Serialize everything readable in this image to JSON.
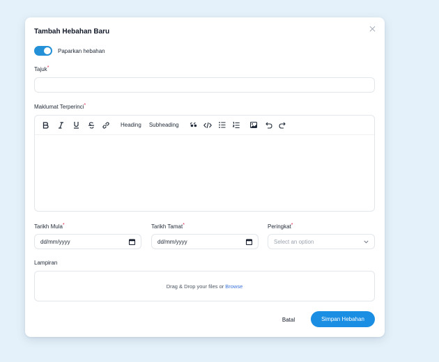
{
  "modal": {
    "title": "Tambah Hebahan Baru",
    "close_icon": "close-icon"
  },
  "toggle": {
    "label": "Paparkan hebahan",
    "on": true,
    "color": "#2490d8"
  },
  "fields": {
    "tajuk": {
      "label": "Tajuk",
      "required_mark": "*",
      "value": ""
    },
    "maklumat": {
      "label": "Maklumat Terperinci",
      "required_mark": "*",
      "value": ""
    },
    "tarikh_mula": {
      "label": "Tarikh Mula",
      "required_mark": "*",
      "value": "dd/mm/yyyy"
    },
    "tarikh_tamat": {
      "label": "Tarikh Tamat",
      "required_mark": "*",
      "value": "dd/mm/yyyy"
    },
    "peringkat": {
      "label": "Peringkat",
      "required_mark": "*",
      "placeholder": "Select an option"
    },
    "lampiran": {
      "label": "Lampiran"
    }
  },
  "toolbar": {
    "items": [
      "bold-icon",
      "italic-icon",
      "underline-icon",
      "strikethrough-icon",
      "link-icon",
      "quote-icon",
      "code-icon",
      "bullet-list-icon",
      "ordered-list-icon",
      "image-icon",
      "undo-icon",
      "redo-icon"
    ],
    "heading": "Heading",
    "subheading": "Subheading"
  },
  "dropzone": {
    "text": "Drag & Drop your files or",
    "browse": "Browse"
  },
  "actions": {
    "cancel": "Batal",
    "save": "Simpan Hebahan"
  },
  "colors": {
    "accent": "#1a8ee3",
    "link": "#3b72d9",
    "required": "#e11d48",
    "background": "#e5f1fa"
  }
}
